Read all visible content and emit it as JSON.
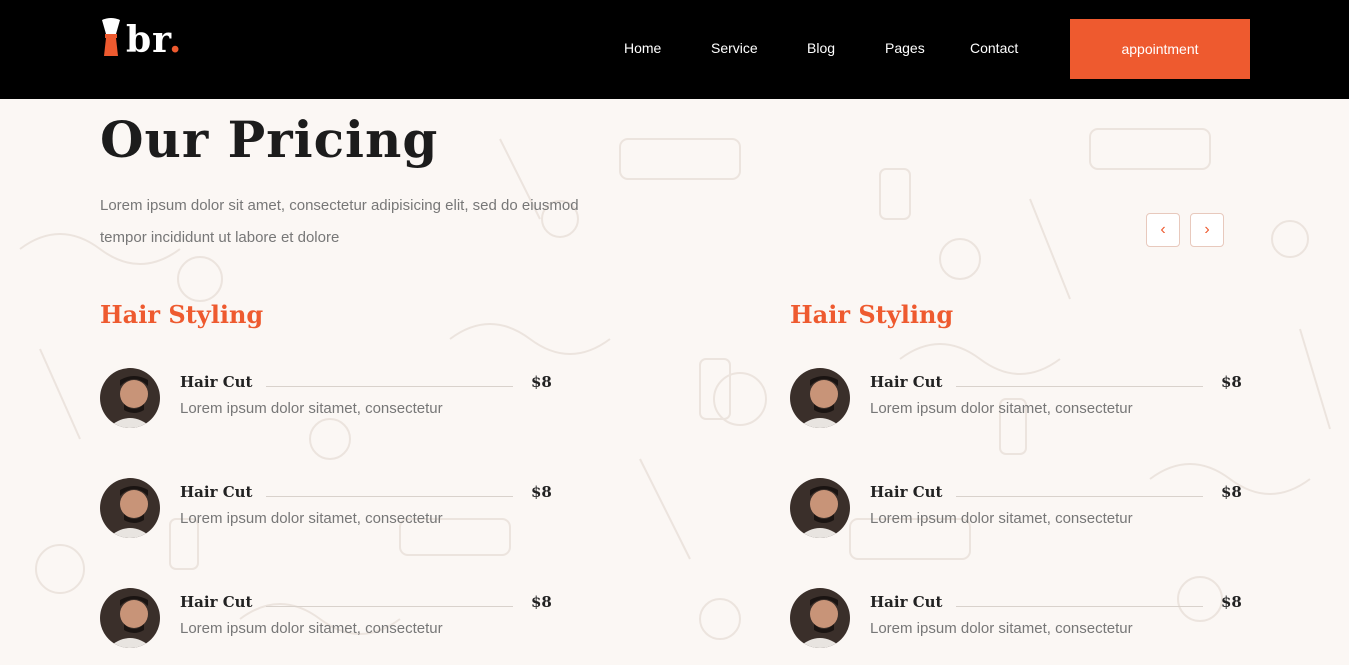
{
  "brand": {
    "name": "br",
    "dot": ".",
    "accent": "#ee5a2f"
  },
  "nav": {
    "items": [
      {
        "label": "Home"
      },
      {
        "label": "Service"
      },
      {
        "label": "Blog"
      },
      {
        "label": "Pages"
      },
      {
        "label": "Contact"
      }
    ],
    "cta_label": "appointment"
  },
  "section": {
    "title": "Our Pricing",
    "intro": "Lorem ipsum dolor sit amet, consectetur adipisicing elit, sed do eiusmod tempor incididunt ut labore et dolore",
    "prev_icon": "chevron-left-icon",
    "next_icon": "chevron-right-icon"
  },
  "columns": [
    {
      "title": "Hair Styling",
      "items": [
        {
          "name": "Hair Cut",
          "price": "$8",
          "desc": "Lorem ipsum dolor sitamet, consectetur"
        },
        {
          "name": "Hair Cut",
          "price": "$8",
          "desc": "Lorem ipsum dolor sitamet, consectetur"
        },
        {
          "name": "Hair Cut",
          "price": "$8",
          "desc": "Lorem ipsum dolor sitamet, consectetur"
        }
      ]
    },
    {
      "title": "Hair Styling",
      "items": [
        {
          "name": "Hair Cut",
          "price": "$8",
          "desc": "Lorem ipsum dolor sitamet, consectetur"
        },
        {
          "name": "Hair Cut",
          "price": "$8",
          "desc": "Lorem ipsum dolor sitamet, consectetur"
        },
        {
          "name": "Hair Cut",
          "price": "$8",
          "desc": "Lorem ipsum dolor sitamet, consectetur"
        }
      ]
    }
  ]
}
